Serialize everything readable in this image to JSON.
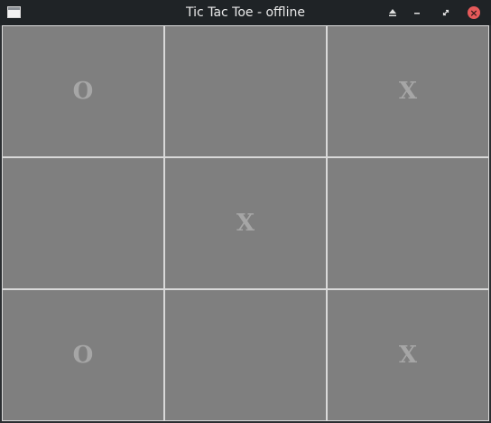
{
  "window": {
    "title": "Tic Tac Toe - offline",
    "icons": [
      "app-window-icon",
      "eject-icon",
      "minimize-icon",
      "restore-icon",
      "close-icon"
    ]
  },
  "board": {
    "cells": [
      [
        "O",
        "",
        "X"
      ],
      [
        "",
        "X",
        ""
      ],
      [
        "O",
        "",
        "X"
      ]
    ]
  },
  "colors": {
    "titlebar": "#1f2326",
    "cell_fill": "#7f7f7f",
    "cell_border": "#d9d9d9",
    "mark": "#a6a6a6",
    "close_button": "#e65a5a"
  }
}
